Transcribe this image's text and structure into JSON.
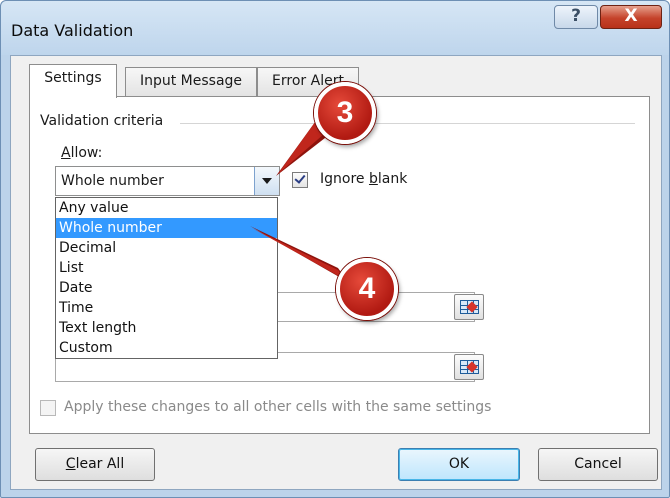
{
  "window": {
    "title": "Data Validation",
    "help_label": "?",
    "close_label": "X"
  },
  "tabs": [
    {
      "label": "Settings",
      "active": true
    },
    {
      "label": "Input Message",
      "active": false
    },
    {
      "label": "Error Alert",
      "active": false
    }
  ],
  "settings": {
    "group_label": "Validation criteria",
    "allow_label": "Allow:",
    "allow_value": "Whole number",
    "ignore_blank_label": "Ignore blank",
    "ignore_blank_checked": true,
    "apply_label": "Apply these changes to all other cells with the same settings",
    "apply_checked": false
  },
  "dropdown": {
    "options": [
      "Any value",
      "Whole number",
      "Decimal",
      "List",
      "Date",
      "Time",
      "Text length",
      "Custom"
    ],
    "selected_index": 1
  },
  "icons": {
    "range_reference": "range-selector-icon",
    "dropdown": "chevron-down-icon",
    "checkbox": "check-icon"
  },
  "buttons": {
    "clear_all": "Clear All",
    "ok": "OK",
    "cancel": "Cancel"
  },
  "callouts": [
    "3",
    "4"
  ],
  "colors": {
    "selection": "#3399ff",
    "callout": "#c0261c",
    "titlebar": "#bed5ec"
  }
}
